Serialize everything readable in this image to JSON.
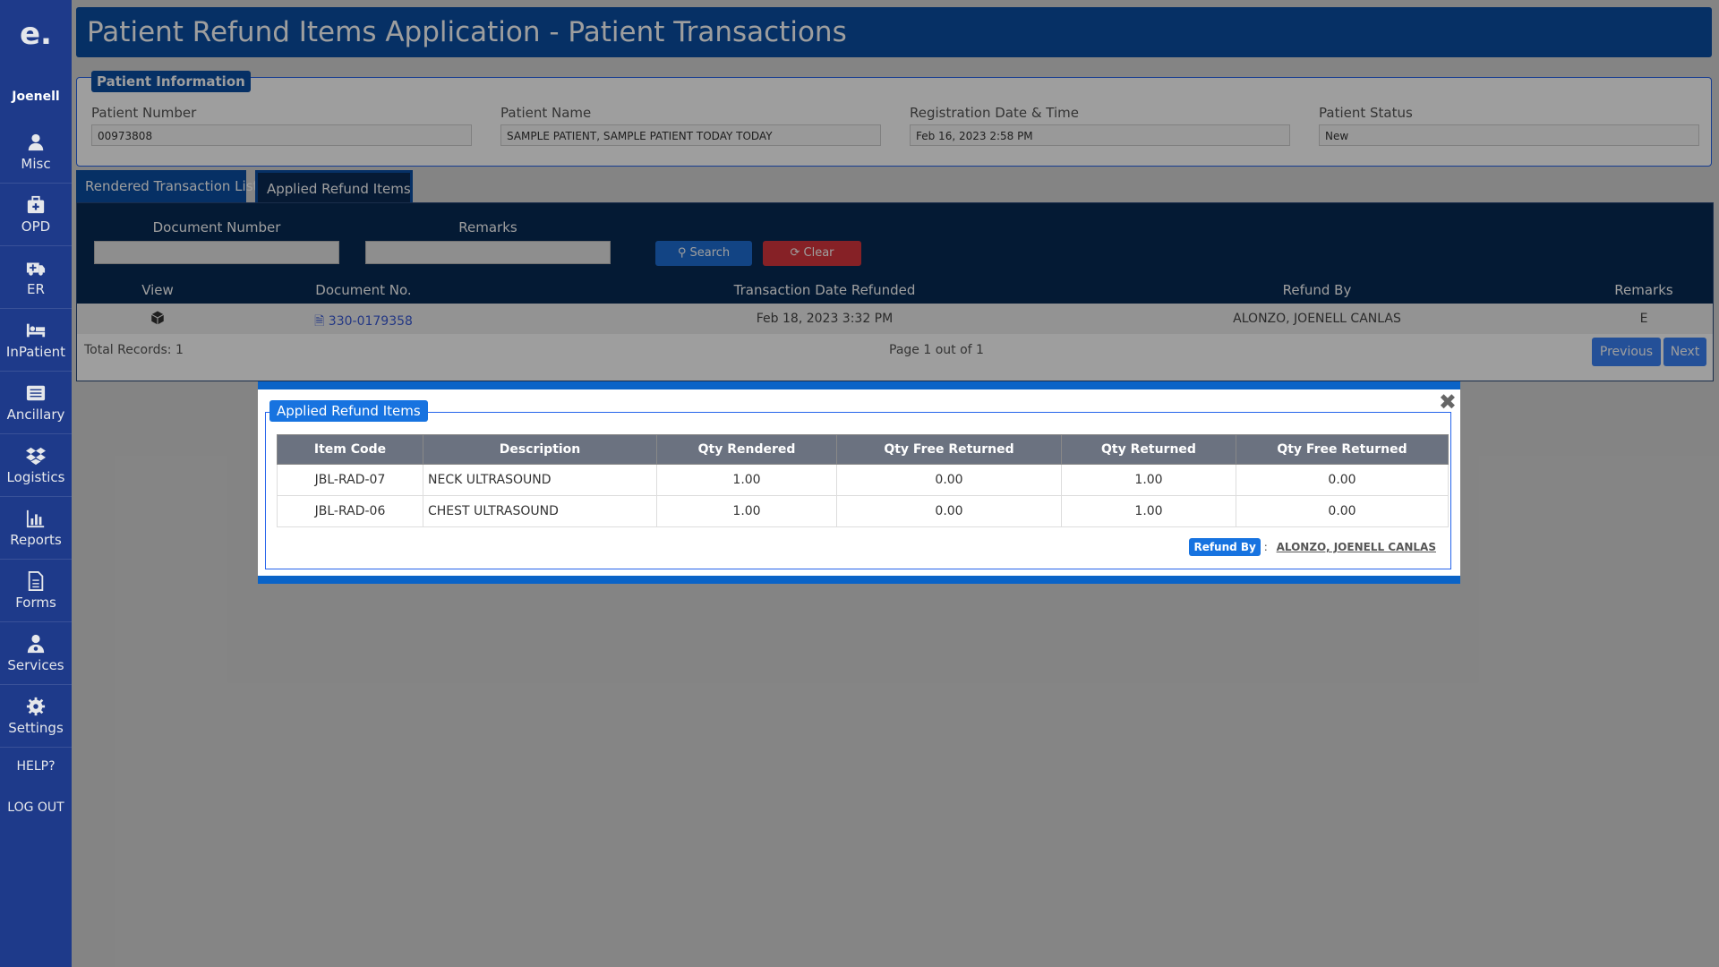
{
  "app": {
    "logo": "e.",
    "title": "Patient Refund Items Application - Patient Transactions"
  },
  "sidebar": {
    "user": "Joenell",
    "items": [
      {
        "label": "Misc",
        "icon": "user-icon"
      },
      {
        "label": "OPD",
        "icon": "medkit-icon"
      },
      {
        "label": "ER",
        "icon": "ambulance-icon"
      },
      {
        "label": "InPatient",
        "icon": "bed-icon"
      },
      {
        "label": "Ancillary",
        "icon": "list-icon"
      },
      {
        "label": "Logistics",
        "icon": "dropbox-icon"
      },
      {
        "label": "Reports",
        "icon": "bar-chart-icon"
      },
      {
        "label": "Forms",
        "icon": "document-icon"
      },
      {
        "label": "Services",
        "icon": "user-md-icon"
      },
      {
        "label": "Settings",
        "icon": "gear-icon"
      }
    ],
    "help": "HELP?",
    "logout": "LOG OUT"
  },
  "patient_info": {
    "legend": "Patient Information",
    "fields": [
      {
        "label": "Patient Number",
        "value": "00973808"
      },
      {
        "label": "Patient Name",
        "value": "SAMPLE PATIENT, SAMPLE PATIENT TODAY TODAY"
      },
      {
        "label": "Registration Date & Time",
        "value": "Feb 16, 2023 2:58 PM"
      },
      {
        "label": "Patient Status",
        "value": "New"
      }
    ]
  },
  "tabs": [
    {
      "label": "Rendered Transaction List"
    },
    {
      "label": "Applied Refund Items"
    }
  ],
  "filters": {
    "doc_label": "Document Number",
    "remarks_label": "Remarks",
    "search_label": "Search",
    "clear_label": "Clear"
  },
  "table": {
    "headers": [
      "View",
      "Document No.",
      "Transaction Date Refunded",
      "Refund By",
      "Remarks"
    ],
    "rows": [
      {
        "doc": "330-0179358",
        "date": "Feb 18, 2023 3:32 PM",
        "by": "ALONZO, JOENELL CANLAS",
        "remarks": "E"
      }
    ],
    "total": "Total Records: 1",
    "page": "Page 1 out of 1",
    "prev": "Previous",
    "next": "Next"
  },
  "modal": {
    "legend": "Applied Refund Items",
    "headers": [
      "Item Code",
      "Description",
      "Qty Rendered",
      "Qty Free Returned",
      "Qty Returned",
      "Qty Free Returned"
    ],
    "rows": [
      [
        "JBL-RAD-07",
        "NECK ULTRASOUND",
        "1.00",
        "0.00",
        "1.00",
        "0.00"
      ],
      [
        "JBL-RAD-06",
        "CHEST ULTRASOUND",
        "1.00",
        "0.00",
        "1.00",
        "0.00"
      ]
    ],
    "refund_by_label": "Refund By",
    "refund_separator": ":",
    "refund_by_value": "ALONZO, JOENELL CANLAS"
  },
  "colors": {
    "sidebar": "#1e3a8a",
    "header": "#0a4ea3",
    "panel_dark": "#082a55",
    "search": "#1d6fd6",
    "clear": "#d9363e",
    "modal_border": "#0a63c7"
  }
}
